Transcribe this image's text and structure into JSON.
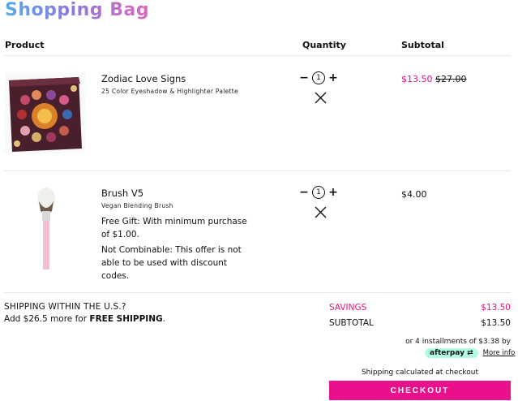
{
  "page": {
    "title": "Shopping Bag"
  },
  "columns": {
    "product": "Product",
    "quantity": "Quantity",
    "subtotal": "Subtotal"
  },
  "items": [
    {
      "name": "Zodiac Love Signs",
      "subtitle": "25 Color Eyeshadow & Highlighter Palette",
      "quantity": "1",
      "price_sale": "$13.50",
      "price_original": "$27.00",
      "notes": []
    },
    {
      "name": "Brush V5",
      "subtitle": "Vegan Blending Brush",
      "quantity": "1",
      "price": "$4.00",
      "notes": [
        "Free Gift: With minimum purchase of $1.00.",
        "Not Combinable: This offer is not able to be used with discount codes."
      ]
    }
  ],
  "shipping": {
    "heading": "SHIPPING WITHIN THE U.S.?",
    "message_prefix": "Add $26.5 more for",
    "message_bold": "FREE SHIPPING",
    "message_suffix": "."
  },
  "summary": {
    "savings_label": "SAVINGS",
    "savings_value": "$13.50",
    "subtotal_label": "SUBTOTAL",
    "subtotal_value": "$13.50",
    "installments_text": "or 4 installments of $3.38",
    "installments_by": "by",
    "afterpay_label": "afterpay",
    "more_info": "More info",
    "shipping_note": "Shipping calculated at checkout",
    "checkout_label": "CHECKOUT"
  },
  "icons": {
    "minus": "minus-icon",
    "plus": "plus-icon",
    "remove": "close-icon"
  },
  "colors": {
    "accent": "#ea0f8a",
    "sale": "#e0157f",
    "afterpay": "#b2fce4"
  }
}
